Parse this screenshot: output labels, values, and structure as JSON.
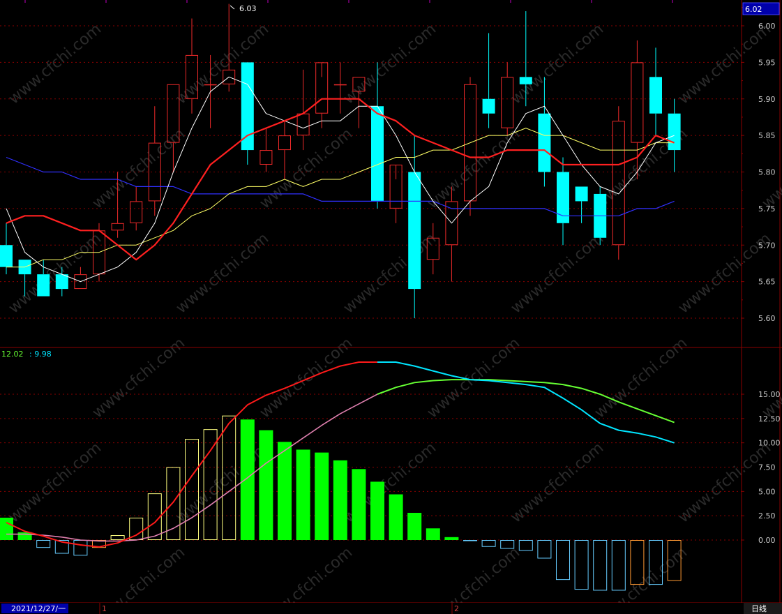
{
  "colors": {
    "up": "#f02a2a",
    "down": "#00ffff",
    "grid": "#8b0000",
    "axisText": "#c8c8c8",
    "ma5": "#ffffff",
    "ma10": "#ff2020",
    "ma20": "#ffff66",
    "ma60": "#3030ff",
    "dif": "#ff1a1a",
    "dea": "#e080b0",
    "difLate": "#00e5ff",
    "deaLate": "#66ff33",
    "histUpGrow": "#ffff80",
    "histUpShrink": "#00ff00",
    "histDnGrow": "#66ccff",
    "histDnShrink": "#ff9933"
  },
  "header": {
    "last_price": "6.02",
    "dif_value": "12.02",
    "dea_value": ": 9.98"
  },
  "footer": {
    "date_label": "2021/12/27/一",
    "month_1": "1",
    "month_2": "2",
    "period": "日线"
  },
  "chart_data": [
    {
      "type": "candlestick",
      "name": "price",
      "high_annotation": "6.03",
      "ylim": [
        5.56,
        6.03
      ],
      "yticks": [
        "6.00",
        "5.95",
        "5.90",
        "5.85",
        "5.80",
        "5.75",
        "5.70",
        "5.65",
        "5.60"
      ],
      "candles": [
        {
          "o": 5.7,
          "h": 5.73,
          "l": 5.66,
          "c": 5.67
        },
        {
          "o": 5.68,
          "h": 5.68,
          "l": 5.63,
          "c": 5.66
        },
        {
          "o": 5.66,
          "h": 5.68,
          "l": 5.63,
          "c": 5.63
        },
        {
          "o": 5.66,
          "h": 5.67,
          "l": 5.63,
          "c": 5.64
        },
        {
          "o": 5.64,
          "h": 5.67,
          "l": 5.64,
          "c": 5.66
        },
        {
          "o": 5.66,
          "h": 5.73,
          "l": 5.65,
          "c": 5.72
        },
        {
          "o": 5.72,
          "h": 5.8,
          "l": 5.71,
          "c": 5.73
        },
        {
          "o": 5.73,
          "h": 5.78,
          "l": 5.72,
          "c": 5.76
        },
        {
          "o": 5.76,
          "h": 5.89,
          "l": 5.74,
          "c": 5.84
        },
        {
          "o": 5.84,
          "h": 5.92,
          "l": 5.8,
          "c": 5.92
        },
        {
          "o": 5.9,
          "h": 6.01,
          "l": 5.88,
          "c": 5.96
        },
        {
          "o": 5.92,
          "h": 5.96,
          "l": 5.86,
          "c": 5.92
        },
        {
          "o": 5.92,
          "h": 6.03,
          "l": 5.91,
          "c": 5.94
        },
        {
          "o": 5.95,
          "h": 5.95,
          "l": 5.81,
          "c": 5.83
        },
        {
          "o": 5.81,
          "h": 5.86,
          "l": 5.8,
          "c": 5.83
        },
        {
          "o": 5.83,
          "h": 5.87,
          "l": 5.79,
          "c": 5.85
        },
        {
          "o": 5.85,
          "h": 5.94,
          "l": 5.83,
          "c": 5.88
        },
        {
          "o": 5.88,
          "h": 5.93,
          "l": 5.86,
          "c": 5.95
        },
        {
          "o": 5.92,
          "h": 5.95,
          "l": 5.88,
          "c": 5.92
        },
        {
          "o": 5.91,
          "h": 5.93,
          "l": 5.86,
          "c": 5.93
        },
        {
          "o": 5.89,
          "h": 5.95,
          "l": 5.75,
          "c": 5.76
        },
        {
          "o": 5.75,
          "h": 5.79,
          "l": 5.73,
          "c": 5.81
        },
        {
          "o": 5.8,
          "h": 5.85,
          "l": 5.6,
          "c": 5.64
        },
        {
          "o": 5.68,
          "h": 5.73,
          "l": 5.66,
          "c": 5.71
        },
        {
          "o": 5.7,
          "h": 5.78,
          "l": 5.65,
          "c": 5.76
        },
        {
          "o": 5.76,
          "h": 5.93,
          "l": 5.74,
          "c": 5.92
        },
        {
          "o": 5.9,
          "h": 5.99,
          "l": 5.86,
          "c": 5.88
        },
        {
          "o": 5.86,
          "h": 5.95,
          "l": 5.85,
          "c": 5.93
        },
        {
          "o": 5.93,
          "h": 6.02,
          "l": 5.89,
          "c": 5.92
        },
        {
          "o": 5.88,
          "h": 5.93,
          "l": 5.78,
          "c": 5.8
        },
        {
          "o": 5.8,
          "h": 5.82,
          "l": 5.7,
          "c": 5.73
        },
        {
          "o": 5.78,
          "h": 5.78,
          "l": 5.73,
          "c": 5.76
        },
        {
          "o": 5.77,
          "h": 5.78,
          "l": 5.7,
          "c": 5.71
        },
        {
          "o": 5.7,
          "h": 5.89,
          "l": 5.68,
          "c": 5.87
        },
        {
          "o": 5.84,
          "h": 5.98,
          "l": 5.79,
          "c": 5.95
        },
        {
          "o": 5.93,
          "h": 5.97,
          "l": 5.85,
          "c": 5.88
        },
        {
          "o": 5.88,
          "h": 5.9,
          "l": 5.8,
          "c": 5.83
        }
      ],
      "ma5": [
        5.75,
        5.69,
        5.67,
        5.66,
        5.65,
        5.66,
        5.67,
        5.69,
        5.73,
        5.8,
        5.86,
        5.91,
        5.93,
        5.92,
        5.88,
        5.87,
        5.86,
        5.87,
        5.87,
        5.89,
        5.89,
        5.85,
        5.8,
        5.76,
        5.73,
        5.76,
        5.78,
        5.84,
        5.88,
        5.89,
        5.85,
        5.81,
        5.78,
        5.77,
        5.8,
        5.84,
        5.85
      ],
      "ma10": [
        5.73,
        5.74,
        5.74,
        5.73,
        5.72,
        5.72,
        5.7,
        5.68,
        5.7,
        5.73,
        5.77,
        5.81,
        5.83,
        5.85,
        5.86,
        5.87,
        5.88,
        5.9,
        5.9,
        5.9,
        5.88,
        5.87,
        5.85,
        5.84,
        5.83,
        5.82,
        5.82,
        5.83,
        5.83,
        5.83,
        5.81,
        5.81,
        5.81,
        5.81,
        5.82,
        5.85,
        5.84
      ],
      "ma20": [
        5.67,
        5.67,
        5.68,
        5.68,
        5.69,
        5.69,
        5.7,
        5.7,
        5.71,
        5.72,
        5.74,
        5.75,
        5.77,
        5.78,
        5.78,
        5.79,
        5.78,
        5.79,
        5.79,
        5.8,
        5.81,
        5.82,
        5.82,
        5.83,
        5.83,
        5.84,
        5.85,
        5.85,
        5.86,
        5.85,
        5.85,
        5.84,
        5.83,
        5.83,
        5.83,
        5.84,
        5.84
      ],
      "ma60": [
        5.82,
        5.81,
        5.8,
        5.8,
        5.79,
        5.79,
        5.79,
        5.78,
        5.78,
        5.78,
        5.77,
        5.77,
        5.77,
        5.77,
        5.77,
        5.77,
        5.77,
        5.76,
        5.76,
        5.76,
        5.76,
        5.76,
        5.76,
        5.76,
        5.75,
        5.75,
        5.75,
        5.75,
        5.75,
        5.75,
        5.74,
        5.74,
        5.74,
        5.74,
        5.75,
        5.75,
        5.76
      ]
    },
    {
      "type": "macd",
      "name": "macd",
      "ylim": [
        -6.5,
        18.6
      ],
      "yticks": [
        "15.00",
        "12.50",
        "10.00",
        "7.50",
        "5.00",
        "2.50",
        "0.00"
      ],
      "dif": [
        1.8,
        0.9,
        0.4,
        -0.2,
        -0.5,
        -0.7,
        -0.3,
        0.5,
        1.8,
        3.9,
        6.6,
        9.2,
        12.0,
        13.9,
        14.9,
        15.6,
        16.4,
        17.2,
        17.9,
        18.3,
        18.3,
        18.3,
        17.9,
        17.4,
        16.9,
        16.5,
        16.4,
        16.2,
        16.0,
        15.7,
        14.6,
        13.4,
        12.0,
        11.3,
        11.0,
        10.6,
        10.0
      ],
      "dea": [
        0.6,
        0.6,
        0.5,
        0.3,
        0.0,
        -0.1,
        -0.1,
        0.0,
        0.4,
        1.2,
        2.3,
        3.6,
        5.0,
        6.4,
        7.9,
        9.2,
        10.5,
        11.8,
        13.0,
        14.0,
        15.0,
        15.7,
        16.2,
        16.4,
        16.5,
        16.5,
        16.5,
        16.4,
        16.3,
        16.2,
        16.0,
        15.6,
        15.0,
        14.2,
        13.5,
        12.8,
        12.1
      ],
      "hist": [
        2.3,
        0.8,
        -0.8,
        -1.4,
        -1.6,
        -0.8,
        0.5,
        2.3,
        4.8,
        7.5,
        10.4,
        11.4,
        12.8,
        12.4,
        11.3,
        10.1,
        9.3,
        9.0,
        8.2,
        7.3,
        6.0,
        4.7,
        2.8,
        1.2,
        0.3,
        -0.1,
        -0.7,
        -0.9,
        -1.1,
        -1.9,
        -4.1,
        -5.1,
        -5.2,
        -5.2,
        -4.6,
        -4.6,
        -4.2
      ]
    }
  ]
}
